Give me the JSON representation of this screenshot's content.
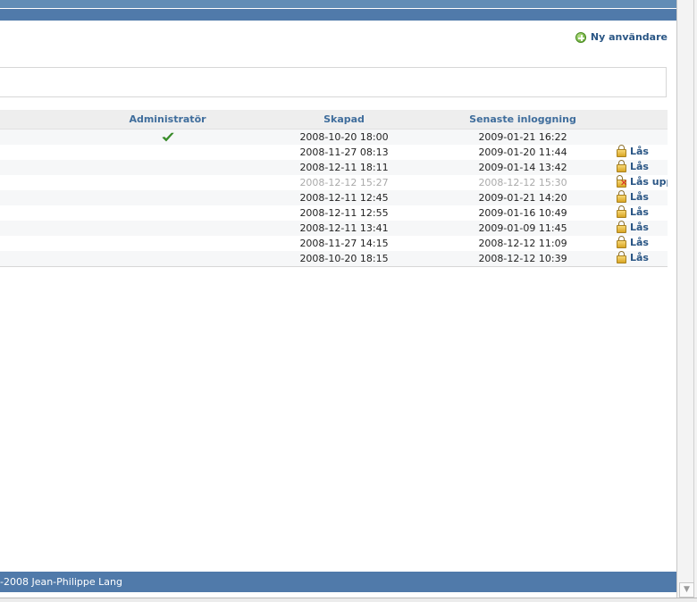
{
  "header": {
    "new_user_label": "Ny användare",
    "new_user_icon": "add-icon"
  },
  "table": {
    "columns": [
      "Administratör",
      "Skapad",
      "Senaste inloggning"
    ],
    "rows": [
      {
        "admin": true,
        "created": "2008-10-20 18:00",
        "last_login": "2009-01-21 16:22",
        "action": "",
        "locked": false
      },
      {
        "admin": false,
        "created": "2008-11-27 08:13",
        "last_login": "2009-01-20 11:44",
        "action": "Lås",
        "locked": false
      },
      {
        "admin": false,
        "created": "2008-12-11 18:11",
        "last_login": "2009-01-14 13:42",
        "action": "Lås",
        "locked": false
      },
      {
        "admin": false,
        "created": "2008-12-12 15:27",
        "last_login": "2008-12-12 15:30",
        "action": "Lås upp",
        "locked": true
      },
      {
        "admin": false,
        "created": "2008-12-11 12:45",
        "last_login": "2009-01-21 14:20",
        "action": "Lås",
        "locked": false
      },
      {
        "admin": false,
        "created": "2008-12-11 12:55",
        "last_login": "2009-01-16 10:49",
        "action": "Lås",
        "locked": false
      },
      {
        "admin": false,
        "created": "2008-12-11 13:41",
        "last_login": "2009-01-09 11:45",
        "action": "Lås",
        "locked": false
      },
      {
        "admin": false,
        "created": "2008-11-27 14:15",
        "last_login": "2008-12-12 11:09",
        "action": "Lås",
        "locked": false
      },
      {
        "admin": false,
        "created": "2008-10-20 18:15",
        "last_login": "2008-12-12 10:39",
        "action": "Lås",
        "locked": false
      }
    ]
  },
  "footer": {
    "text": "-2008 Jean-Philippe Lang"
  },
  "colors": {
    "header_bar": "#507aaa",
    "link": "#2a5685",
    "column_header": "#3f6d9c"
  }
}
